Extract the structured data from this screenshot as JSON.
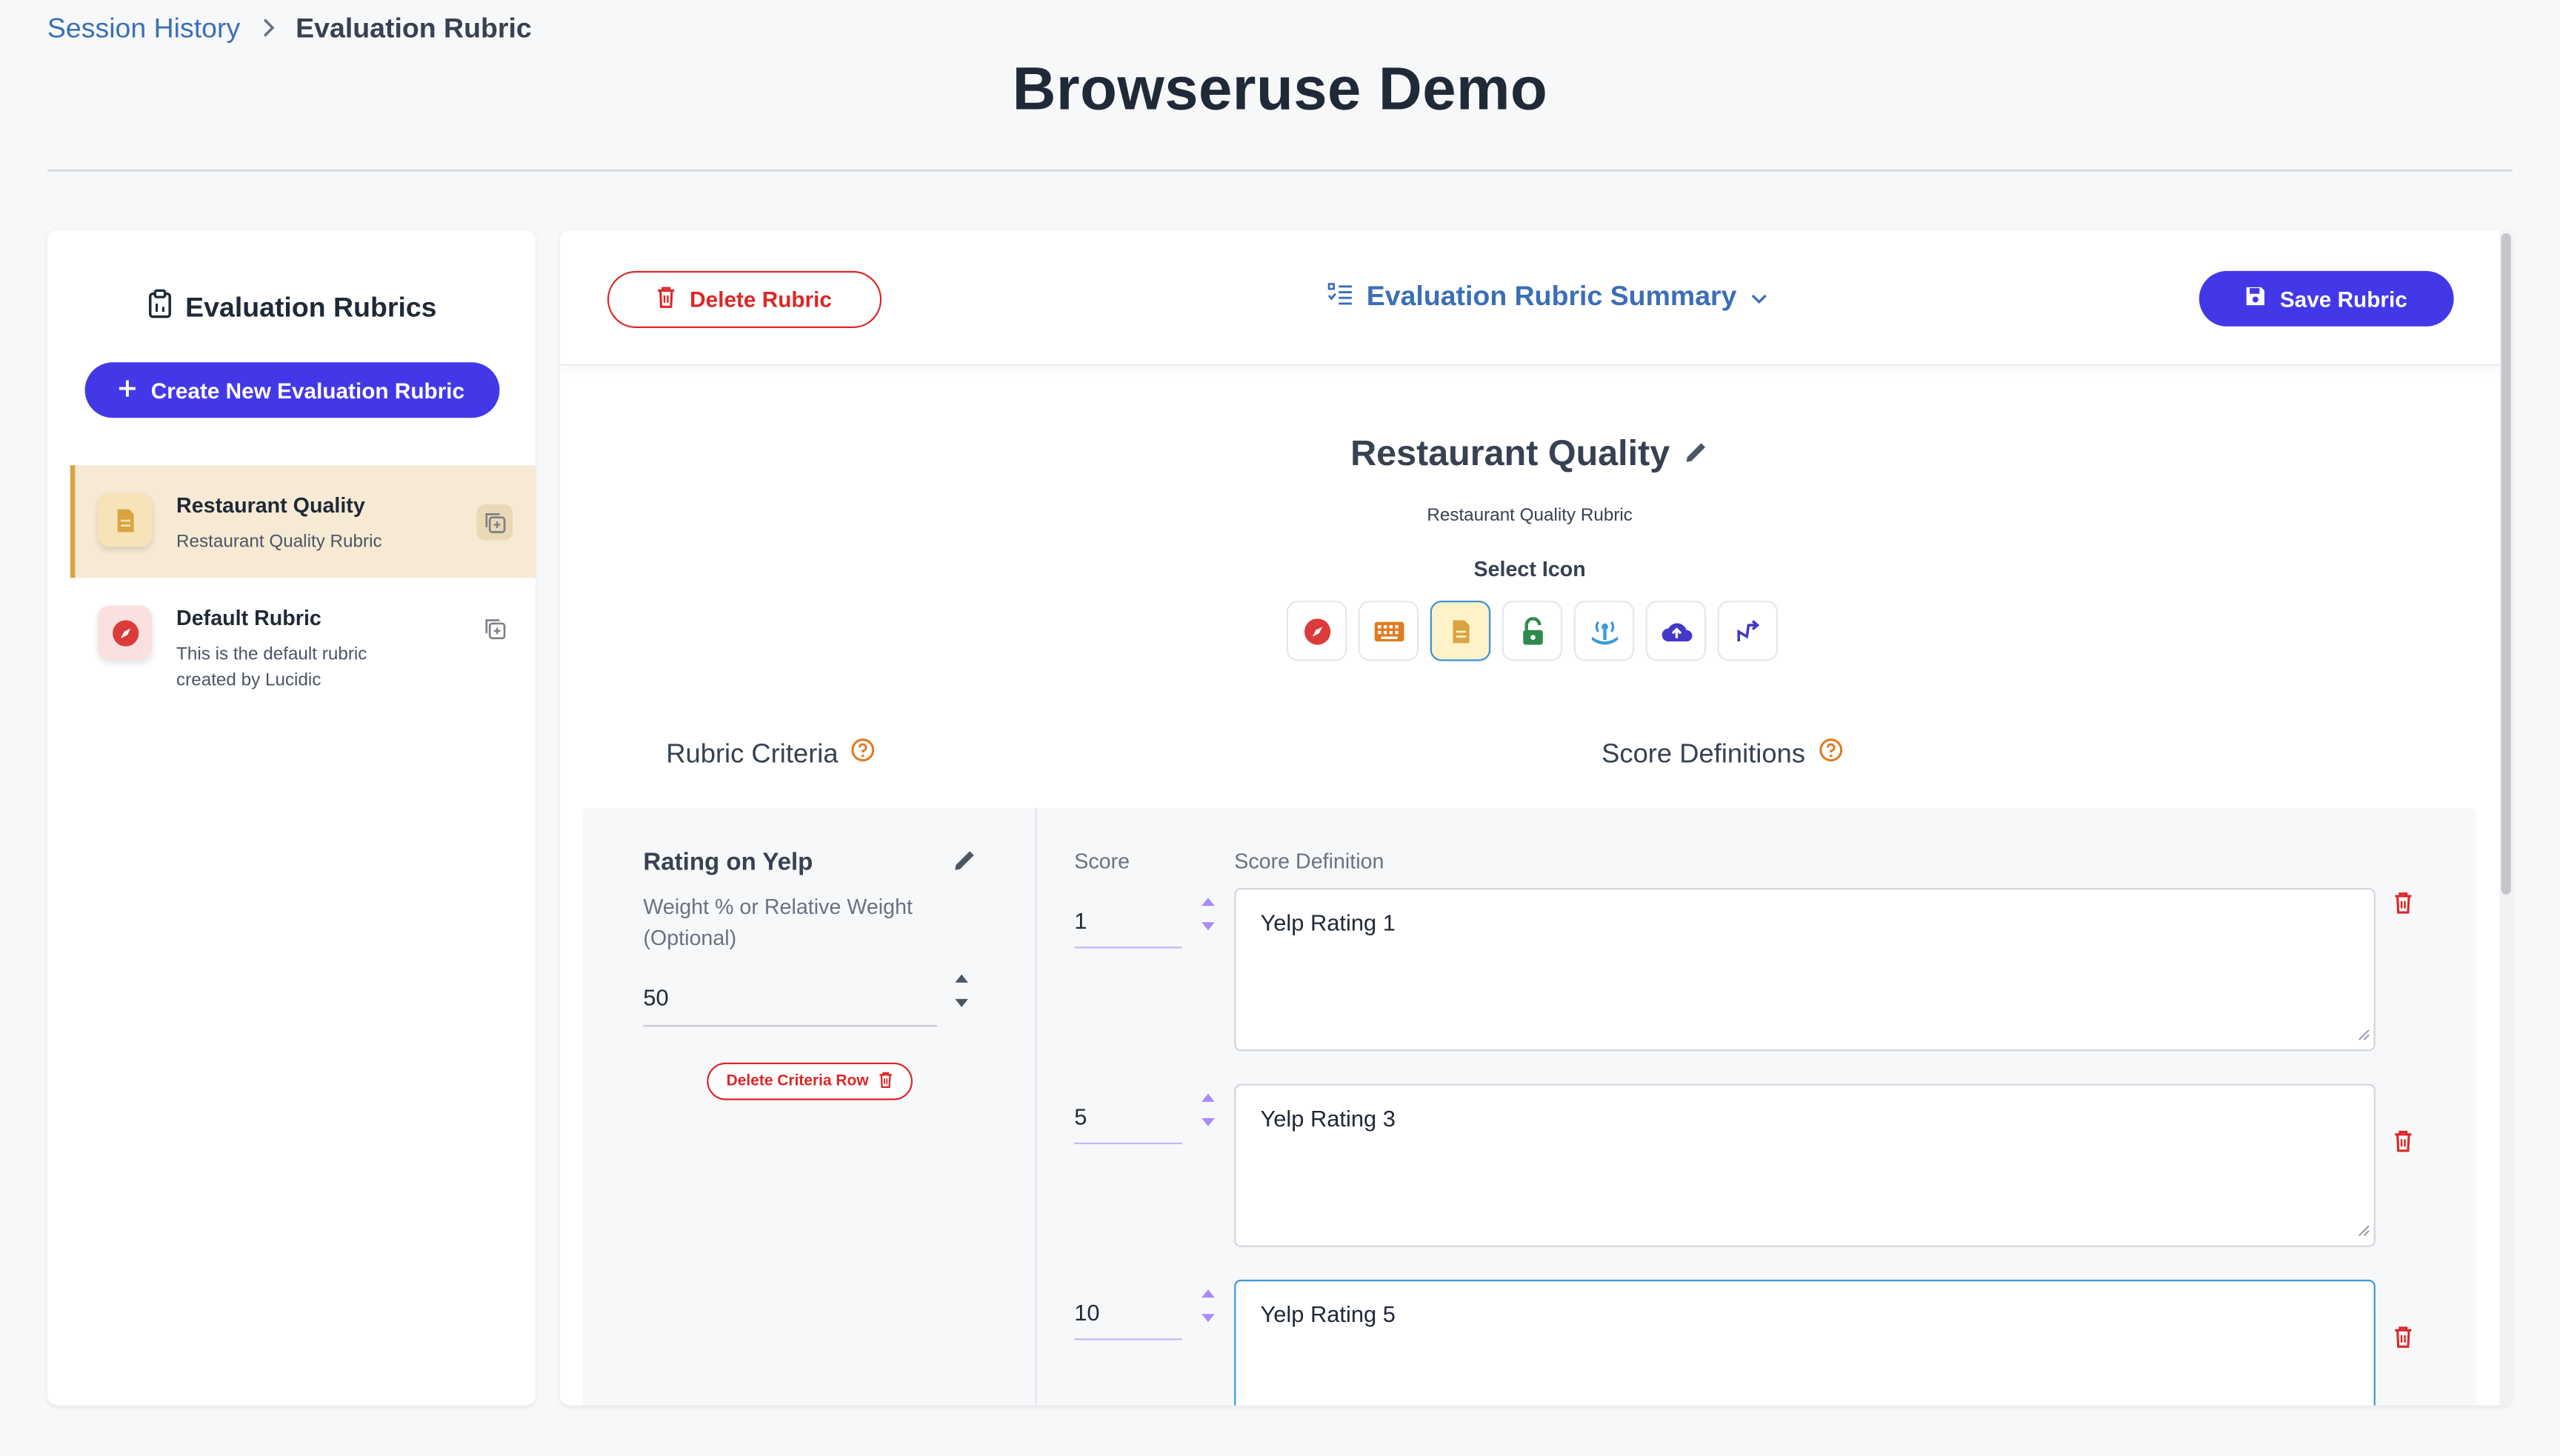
{
  "breadcrumb": {
    "parent": "Session History",
    "current": "Evaluation Rubric"
  },
  "page_title": "Browseruse Demo",
  "sidebar": {
    "heading": "Evaluation Rubrics",
    "create_label": "Create New Evaluation Rubric",
    "items": [
      {
        "name": "Restaurant Quality",
        "desc": "Restaurant Quality Rubric",
        "icon": "document-icon",
        "active": true
      },
      {
        "name": "Default Rubric",
        "desc": "This is the default rubric created by Lucidic",
        "icon": "compass-icon",
        "active": false
      }
    ]
  },
  "toolbar": {
    "delete_label": "Delete Rubric",
    "summary_label": "Evaluation Rubric Summary",
    "save_label": "Save Rubric"
  },
  "rubric": {
    "name": "Restaurant Quality",
    "subtitle": "Restaurant Quality Rubric",
    "select_icon_label": "Select Icon",
    "icon_options": [
      "compass-icon",
      "keyboard-icon",
      "document-icon",
      "unlock-icon",
      "signal-icon",
      "cloud-upload-icon",
      "graph-icon"
    ],
    "selected_icon": "document-icon"
  },
  "sections": {
    "criteria_label": "Rubric Criteria",
    "score_defs_label": "Score Definitions"
  },
  "criteria": [
    {
      "name": "Rating on Yelp",
      "weight_label": "Weight % or Relative Weight (Optional)",
      "weight_value": "50",
      "delete_label": "Delete Criteria Row",
      "score_header": "Score",
      "definition_header": "Score Definition",
      "scores": [
        {
          "score": "1",
          "definition": "Yelp Rating 1"
        },
        {
          "score": "5",
          "definition": "Yelp Rating 3"
        },
        {
          "score": "10",
          "definition": "Yelp Rating 5"
        }
      ]
    }
  ],
  "colors": {
    "primary": "#4338e8",
    "danger": "#dc2626",
    "link": "#3b6fb6",
    "active_item_bg": "#f6ead4",
    "help_icon": "#e07b1f"
  }
}
